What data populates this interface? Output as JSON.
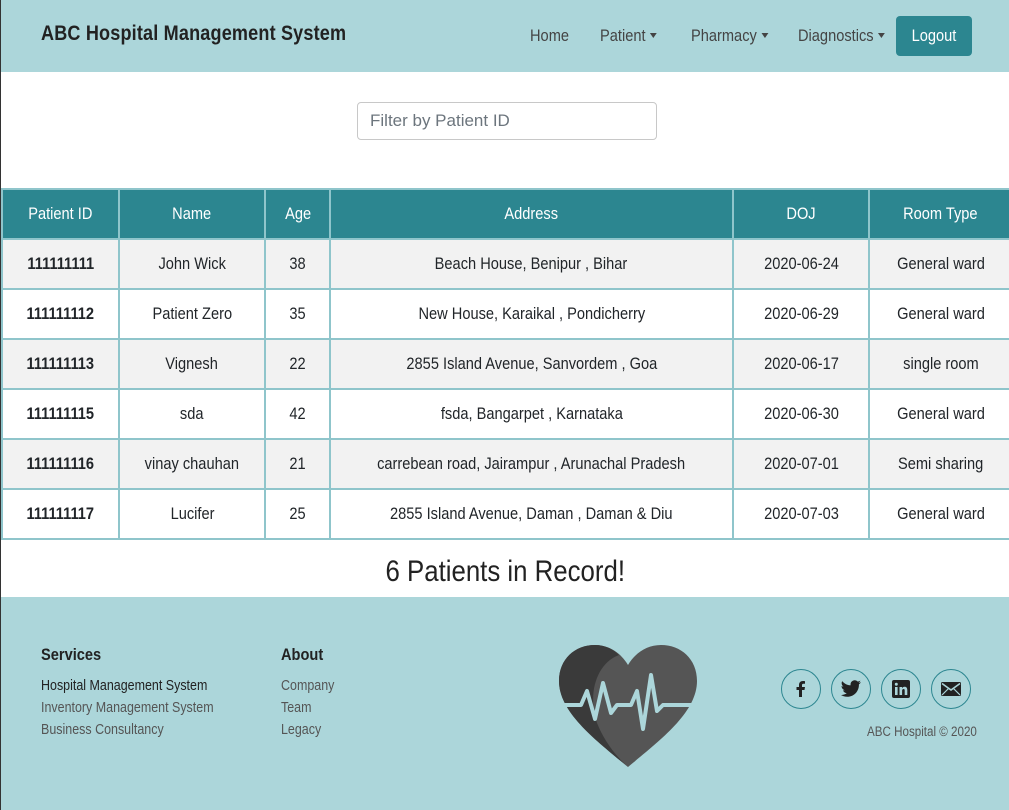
{
  "header": {
    "brand": "ABC Hospital Management System",
    "nav": [
      "Home",
      "Patient",
      "Pharmacy",
      "Diagnostics"
    ],
    "logout": "Logout"
  },
  "filter": {
    "placeholder": "Filter by Patient ID"
  },
  "table": {
    "columns": [
      "Patient ID",
      "Name",
      "Age",
      "Address",
      "DOJ",
      "Room Type"
    ],
    "rows": [
      [
        "111111111",
        "John Wick",
        "38",
        "Beach House, Benipur , Bihar",
        "2020-06-24",
        "General ward"
      ],
      [
        "111111112",
        "Patient Zero",
        "35",
        "New House, Karaikal , Pondicherry",
        "2020-06-29",
        "General ward"
      ],
      [
        "111111113",
        "Vignesh",
        "22",
        "2855 Island Avenue, Sanvordem , Goa",
        "2020-06-17",
        "single room"
      ],
      [
        "111111115",
        "sda",
        "42",
        "fsda, Bangarpet , Karnataka",
        "2020-06-30",
        "General ward"
      ],
      [
        "111111116",
        "vinay chauhan",
        "21",
        "carrebean road, Jairampur , Arunachal Pradesh",
        "2020-07-01",
        "Semi sharing"
      ],
      [
        "111111117",
        "Lucifer",
        "25",
        "2855 Island Avenue, Daman , Daman & Diu",
        "2020-07-03",
        "General ward"
      ]
    ]
  },
  "summary": "6 Patients in Record!",
  "footer": {
    "services": {
      "title": "Services",
      "links": [
        "Hospital Management System",
        "Inventory Management System",
        "Business Consultancy"
      ]
    },
    "about": {
      "title": "About",
      "links": [
        "Company",
        "Team",
        "Legacy"
      ]
    },
    "social": [
      "facebook-icon",
      "twitter-icon",
      "linkedin-icon",
      "mail-icon"
    ],
    "copyright": "ABC Hospital © 2020"
  },
  "colors": {
    "accent": "#2c8690",
    "header_bg": "#acd6da",
    "row_alt": "#f2f2f2",
    "border": "#8fc5cb"
  }
}
